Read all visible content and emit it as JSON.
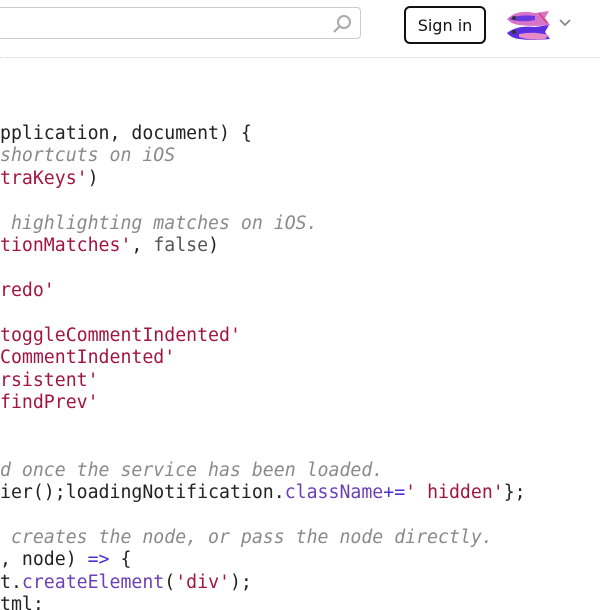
{
  "header": {
    "search_placeholder": "",
    "sign_in_label": "Sign in",
    "icons": {
      "search": "magnifier-icon",
      "logo": "fish-logo",
      "menu": "chevron-down-icon"
    }
  },
  "code_lines": [
    [
      {
        "t": "pplication, document) {",
        "c": ""
      }
    ],
    [
      {
        "t": "shortcuts on iOS",
        "c": "c"
      }
    ],
    [
      {
        "t": "traKeys'",
        "c": "s"
      },
      {
        "t": ")",
        "c": ""
      }
    ],
    [],
    [
      {
        "t": " highlighting matches on iOS.",
        "c": "c"
      }
    ],
    [
      {
        "t": "tionMatches'",
        "c": "s"
      },
      {
        "t": ", ",
        "c": ""
      },
      {
        "t": "false",
        "c": "k"
      },
      {
        "t": ")",
        "c": ""
      }
    ],
    [],
    [
      {
        "t": "redo'",
        "c": "s"
      }
    ],
    [],
    [
      {
        "t": "toggleCommentIndented'",
        "c": "s"
      }
    ],
    [
      {
        "t": "CommentIndented'",
        "c": "s"
      }
    ],
    [
      {
        "t": "rsistent'",
        "c": "s"
      }
    ],
    [
      {
        "t": "findPrev'",
        "c": "s"
      }
    ],
    [],
    [],
    [
      {
        "t": "d once the service has been loaded.",
        "c": "c"
      }
    ],
    [
      {
        "t": "ier();loadingNotification.",
        "c": ""
      },
      {
        "t": "className",
        "c": "p"
      },
      {
        "t": "+=",
        "c": "o"
      },
      {
        "t": "' hidden'",
        "c": "s"
      },
      {
        "t": "};",
        "c": ""
      }
    ],
    [],
    [
      {
        "t": " creates the node, or pass the node directly.",
        "c": "c"
      }
    ],
    [
      {
        "t": ", node) ",
        "c": ""
      },
      {
        "t": "=>",
        "c": "o"
      },
      {
        "t": " {",
        "c": ""
      }
    ],
    [
      {
        "t": "t.",
        "c": ""
      },
      {
        "t": "createElement",
        "c": "p"
      },
      {
        "t": "(",
        "c": ""
      },
      {
        "t": "'div'",
        "c": "s"
      },
      {
        "t": ");",
        "c": ""
      }
    ],
    [
      {
        "t": "tml;",
        "c": ""
      }
    ]
  ]
}
